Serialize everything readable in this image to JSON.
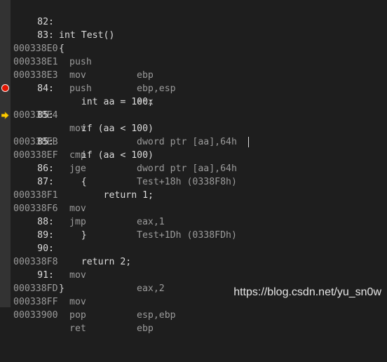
{
  "rows": [
    {
      "kind": "src",
      "num": "82:",
      "code": "int Test()"
    },
    {
      "kind": "src",
      "num": "83:",
      "code": "{"
    },
    {
      "kind": "asm",
      "addr": "000338E0",
      "mnem": "push",
      "ops": "ebp"
    },
    {
      "kind": "asm",
      "addr": "000338E1",
      "mnem": "mov",
      "ops": "ebp,esp"
    },
    {
      "kind": "asm",
      "addr": "000338E3",
      "mnem": "push",
      "ops": "ecx"
    },
    {
      "kind": "src",
      "num": "84:",
      "code": "    int aa = 100;"
    },
    {
      "kind": "asm",
      "addr": "000338E4",
      "mnem": "mov",
      "ops": "dword ptr [aa],64h",
      "marker": "breakpoint"
    },
    {
      "kind": "src",
      "num": "85:",
      "code": "    if (aa < 100)"
    },
    {
      "kind": "asm",
      "addr": "000338EB",
      "mnem": "cmp",
      "ops": "dword ptr [aa],64h",
      "marker": "current-instruction"
    },
    {
      "kind": "src",
      "num": "85:",
      "code": "    if (aa < 100)"
    },
    {
      "kind": "asm",
      "addr": "000338EF",
      "mnem": "jge",
      "ops": "Test+18h (0338F8h)",
      "caret": true
    },
    {
      "kind": "src",
      "num": "86:",
      "code": "    {"
    },
    {
      "kind": "src",
      "num": "87:",
      "code": "        return 1;"
    },
    {
      "kind": "asm",
      "addr": "000338F1",
      "mnem": "mov",
      "ops": "eax,1"
    },
    {
      "kind": "asm",
      "addr": "000338F6",
      "mnem": "jmp",
      "ops": "Test+1Dh (0338FDh)"
    },
    {
      "kind": "src",
      "num": "88:",
      "code": "    }"
    },
    {
      "kind": "src",
      "num": "89:",
      "code": ""
    },
    {
      "kind": "src",
      "num": "90:",
      "code": "    return 2;"
    },
    {
      "kind": "asm",
      "addr": "000338F8",
      "mnem": "mov",
      "ops": "eax,2"
    },
    {
      "kind": "src",
      "num": "91:",
      "code": "}"
    },
    {
      "kind": "asm",
      "addr": "000338FD",
      "mnem": "mov",
      "ops": "esp,ebp"
    },
    {
      "kind": "asm",
      "addr": "000338FF",
      "mnem": "pop",
      "ops": "ebp"
    },
    {
      "kind": "asm",
      "addr": "00033900",
      "mnem": "ret",
      "ops": ""
    }
  ],
  "watermark": "https://blog.csdn.net/yu_sn0w",
  "colors": {
    "background": "#1e1e1e",
    "gutter": "#333333",
    "source_text": "#dcdcdc",
    "asm_text": "#9b9b9b",
    "breakpoint": "#e51400",
    "current_arrow": "#ffcc00"
  }
}
